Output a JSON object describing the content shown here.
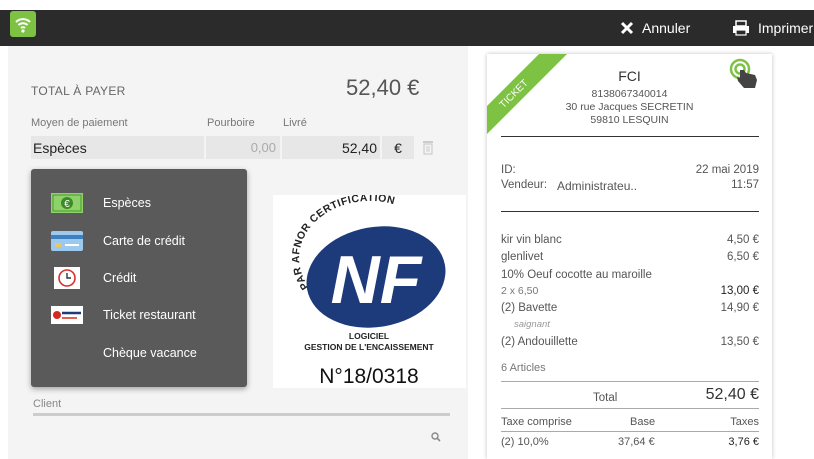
{
  "topbar": {
    "cancel_label": "Annuler",
    "print_label": "Imprimer"
  },
  "payment": {
    "total_label": "TOTAL À PAYER",
    "total_amount": "52,40 €",
    "method_label": "Moyen de paiement",
    "tip_label": "Pourboire",
    "delivered_label": "Livré",
    "method_value": "Espèces",
    "tip_value": "0,00",
    "delivered_value": "52,40",
    "currency_label": "€"
  },
  "menu": {
    "items": [
      {
        "label": "Espèces",
        "icon": "cash-icon"
      },
      {
        "label": "Carte de crédit",
        "icon": "credit-card-icon"
      },
      {
        "label": "Crédit",
        "icon": "clock-icon"
      },
      {
        "label": "Ticket restaurant",
        "icon": "ticket-restaurant-icon"
      },
      {
        "label": "Chèque vacance",
        "icon": ""
      }
    ]
  },
  "certification": {
    "arc_text": "PAR AFNOR CERTIFICATION",
    "logo_letters": "NF",
    "line1": "LOGICIEL",
    "line2": "GESTION DE L'ENCAISSEMENT",
    "number": "N°18/0318"
  },
  "client": {
    "label": "Client"
  },
  "receipt": {
    "ribbon": "TICKET",
    "store_name": "FCI",
    "store_id": "8138067340014",
    "address1": "30 rue Jacques SECRETIN",
    "address2": "59810 LESQUIN",
    "id_label": "ID:",
    "date": "22 mai 2019",
    "seller_label": "Vendeur:",
    "seller_name": "Administrateu..",
    "time": "11:57",
    "lines": [
      {
        "name": "kir vin blanc",
        "price": "4,50 €"
      },
      {
        "name": "glenlivet",
        "price": "6,50 €"
      },
      {
        "name": "10% Oeuf cocotte au maroille",
        "price": ""
      },
      {
        "name": "2 x 6,50",
        "price": "13,00 €"
      },
      {
        "name": "(2) Bavette",
        "price": "14,90 €"
      },
      {
        "name": "saignant",
        "price": ""
      },
      {
        "name": "(2) Andouillette",
        "price": "13,50 €"
      }
    ],
    "articles": "6 Articles",
    "total_label": "Total",
    "total_value": "52,40 €",
    "tax_header": {
      "c1": "Taxe comprise",
      "c2": "Base",
      "c3": "Taxes"
    },
    "tax_row": {
      "c1": "(2) 10,0%",
      "c2": "37,64 €",
      "c3": "3,76 €"
    }
  },
  "colors": {
    "brand_green": "#7dc242",
    "topbar": "#2b2b2b",
    "menu_bg": "#5a5a5a",
    "nf_blue": "#1d3a7a"
  }
}
